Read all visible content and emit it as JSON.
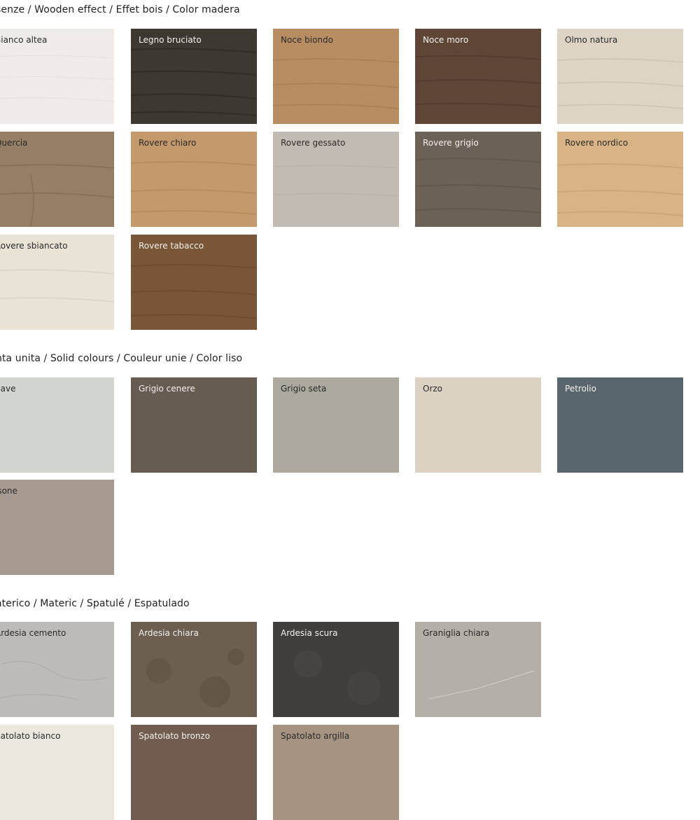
{
  "sections": [
    {
      "title": "senze / Wooden effect / Effet bois / Color madera",
      "swatches": [
        {
          "label": "Bianco altea",
          "color": "#efece8"
        },
        {
          "label": "Legno bruciato",
          "color": "#3e3832"
        },
        {
          "label": "Noce biondo",
          "color": "#b98d62"
        },
        {
          "label": "Noce moro",
          "color": "#5e4536"
        },
        {
          "label": "Olmo natura",
          "color": "#ddd4c6"
        },
        {
          "label": "Quercia",
          "color": "#957e64"
        },
        {
          "label": "Rovere chiaro",
          "color": "#c49a6c"
        },
        {
          "label": "Rovere gessato",
          "color": "#c2bbb2"
        },
        {
          "label": "Rovere grigio",
          "color": "#6b6156"
        },
        {
          "label": "Rovere nordico",
          "color": "#d7b386"
        },
        {
          "label": "Rovere sbiancato",
          "color": "#e8e2d7"
        },
        {
          "label": "Rovere tabacco",
          "color": "#7a5638"
        }
      ]
    },
    {
      "title": "nta unita / Solid colours / Couleur unie / Color liso",
      "swatches": [
        {
          "label": "gave",
          "color": "#d2d4d0"
        },
        {
          "label": "Grigio cenere",
          "color": "#665c52"
        },
        {
          "label": "Grigio seta",
          "color": "#aba89d"
        },
        {
          "label": "Orzo",
          "color": "#dcd2c3"
        },
        {
          "label": "Petrolio",
          "color": "#59666b"
        },
        {
          "label": "isone",
          "color": "#a79b91"
        }
      ]
    },
    {
      "title": "aterico / Materic / Spatulé / Espatulado",
      "swatches": [
        {
          "label": "Ardesia cemento",
          "color": "#bdbbb8"
        },
        {
          "label": "Ardesia chiara",
          "color": "#6c5f51"
        },
        {
          "label": "Ardesia scura",
          "color": "#3f3e3b"
        },
        {
          "label": "Graniglia chiara",
          "color": "#b4b0a9"
        },
        {
          "label": "patolato bianco",
          "color": "#eae7df"
        },
        {
          "label": "Spatolato bronzo",
          "color": "#725c4f"
        },
        {
          "label": "Spatolato argilla",
          "color": "#a79480"
        }
      ]
    }
  ]
}
